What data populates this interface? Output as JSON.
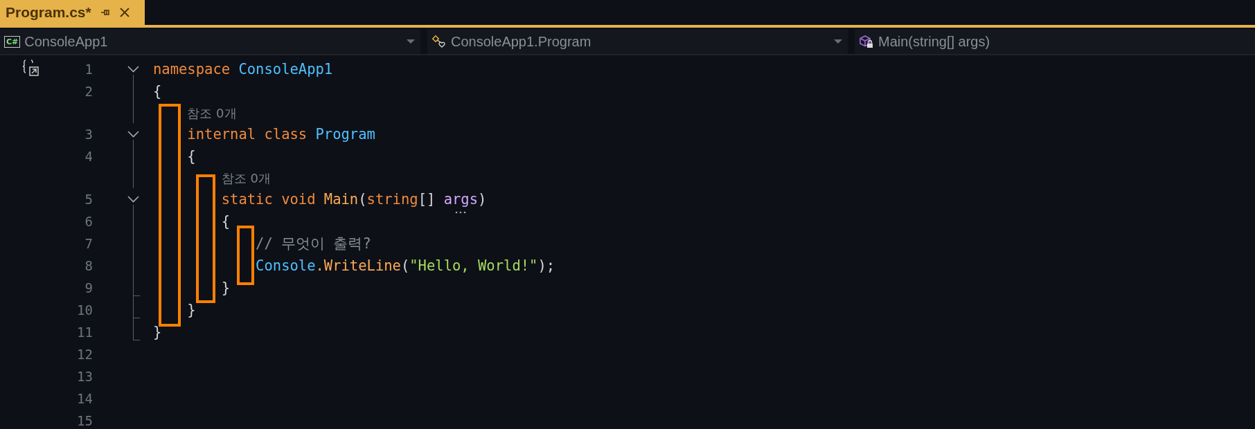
{
  "tab": {
    "title": "Program.cs*",
    "selected": true
  },
  "navigation": [
    {
      "kind": "project",
      "badge": "C#",
      "text": "ConsoleApp1",
      "caret": true
    },
    {
      "kind": "class",
      "text": "ConsoleApp1.Program",
      "caret": true
    },
    {
      "kind": "method",
      "text": "Main(string[] args)",
      "caret": false
    }
  ],
  "rows": [
    {
      "kind": "code",
      "number": "1",
      "collapsible": true,
      "region_line": false,
      "region_end": false,
      "margin_icon": true,
      "tokens": [
        {
          "text": "namespace ",
          "kind": "keyword"
        },
        {
          "text": "ConsoleApp1",
          "kind": "type"
        }
      ]
    },
    {
      "kind": "code",
      "number": "2",
      "collapsible": false,
      "region_line": true,
      "region_end": false,
      "margin_icon": false,
      "tokens": [
        {
          "text": "{",
          "kind": "plain"
        }
      ]
    },
    {
      "kind": "lens",
      "collapsible": false,
      "region_line": true,
      "region_end": false,
      "text": "    참조 0개"
    },
    {
      "kind": "code",
      "number": "3",
      "collapsible": true,
      "region_line": false,
      "region_end": false,
      "margin_icon": false,
      "tokens": [
        {
          "text": "    internal class ",
          "kind": "keyword"
        },
        {
          "text": "Program",
          "kind": "type"
        }
      ]
    },
    {
      "kind": "code",
      "number": "4",
      "collapsible": false,
      "region_line": true,
      "region_end": false,
      "margin_icon": false,
      "tokens": [
        {
          "text": "    {",
          "kind": "plain"
        }
      ]
    },
    {
      "kind": "lens",
      "collapsible": false,
      "region_line": true,
      "region_end": false,
      "text": "        참조 0개"
    },
    {
      "kind": "code",
      "number": "5",
      "collapsible": true,
      "region_line": false,
      "region_end": false,
      "margin_icon": false,
      "tokens": [
        {
          "text": "        static void ",
          "kind": "keyword"
        },
        {
          "text": "Main",
          "kind": "method"
        },
        {
          "text": "(",
          "kind": "plain"
        },
        {
          "text": "string",
          "kind": "keyword"
        },
        {
          "text": "[] ",
          "kind": "plain"
        },
        {
          "text": "args",
          "kind": "parameter",
          "suggestion": true
        },
        {
          "text": ")",
          "kind": "plain"
        }
      ]
    },
    {
      "kind": "code",
      "number": "6",
      "collapsible": false,
      "region_line": true,
      "region_end": false,
      "margin_icon": false,
      "tokens": [
        {
          "text": "        {",
          "kind": "plain"
        }
      ]
    },
    {
      "kind": "code",
      "number": "7",
      "collapsible": false,
      "region_line": true,
      "region_end": false,
      "margin_icon": false,
      "tokens": [
        {
          "text": "            // 무엇이 출력?",
          "kind": "comment"
        }
      ]
    },
    {
      "kind": "code",
      "number": "8",
      "collapsible": false,
      "region_line": true,
      "region_end": false,
      "margin_icon": false,
      "tokens": [
        {
          "text": "            Console",
          "kind": "type"
        },
        {
          "text": ".",
          "kind": "method"
        },
        {
          "text": "WriteLine",
          "kind": "method"
        },
        {
          "text": "(",
          "kind": "plain"
        },
        {
          "text": "\"Hello, World!\"",
          "kind": "string"
        },
        {
          "text": ");",
          "kind": "plain"
        }
      ]
    },
    {
      "kind": "code",
      "number": "9",
      "collapsible": false,
      "region_line": true,
      "region_end": true,
      "margin_icon": false,
      "tokens": [
        {
          "text": "        }",
          "kind": "plain"
        }
      ]
    },
    {
      "kind": "code",
      "number": "10",
      "collapsible": false,
      "region_line": true,
      "region_end": true,
      "margin_icon": false,
      "tokens": [
        {
          "text": "    }",
          "kind": "plain"
        }
      ]
    },
    {
      "kind": "code",
      "number": "11",
      "collapsible": false,
      "region_line": false,
      "region_end": true,
      "margin_icon": false,
      "tokens": [
        {
          "text": "}",
          "kind": "plain"
        }
      ]
    },
    {
      "kind": "code",
      "number": "12",
      "collapsible": false,
      "region_line": false,
      "region_end": false,
      "margin_icon": false
    },
    {
      "kind": "code",
      "number": "13",
      "collapsible": false,
      "region_line": false,
      "region_end": false,
      "margin_icon": false
    },
    {
      "kind": "code",
      "number": "14",
      "collapsible": false,
      "region_line": false,
      "region_end": false,
      "margin_icon": false
    },
    {
      "kind": "code",
      "number": "15",
      "collapsible": false,
      "region_line": false,
      "region_end": false,
      "margin_icon": false
    }
  ],
  "annotation_boxes": [
    {
      "color": "#ff8000"
    },
    {
      "color": "#ff8000"
    },
    {
      "color": "#ff8000"
    }
  ]
}
